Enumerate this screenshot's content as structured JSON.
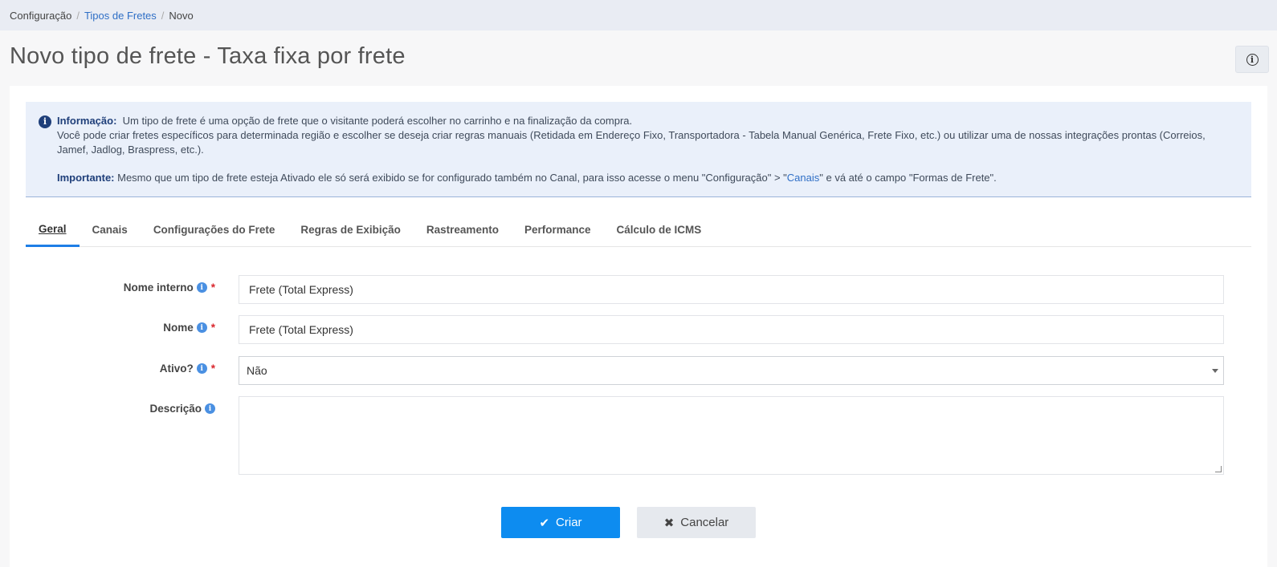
{
  "breadcrumb": {
    "root": "Configuração",
    "parent": "Tipos de Fretes",
    "current": "Novo",
    "separator": "/"
  },
  "page": {
    "title": "Novo tipo de frete - Taxa fixa por frete"
  },
  "alert": {
    "info_label": "Informação:",
    "line1": "Um tipo de frete é uma opção de frete que o visitante poderá escolher no carrinho e na finalização da compra.",
    "line2": "Você pode criar fretes específicos para determinada região e escolher se deseja criar regras manuais (Retidada em Endereço Fixo, Transportadora - Tabela Manual Genérica, Frete Fixo, etc.) ou utilizar uma de nossas integrações prontas (Correios, Jamef, Jadlog, Braspress, etc.).",
    "important_label": "Importante:",
    "important_text_a": "Mesmo que um tipo de frete esteja Ativado ele só será exibido se for configurado também no Canal, para isso acesse o menu \"Configuração\" > \"",
    "important_link": "Canais",
    "important_text_b": "\" e vá até o campo \"Formas de Frete\"."
  },
  "tabs": [
    {
      "label": "Geral",
      "active": true
    },
    {
      "label": "Canais"
    },
    {
      "label": "Configurações do Frete"
    },
    {
      "label": "Regras de Exibição"
    },
    {
      "label": "Rastreamento"
    },
    {
      "label": "Performance"
    },
    {
      "label": "Cálculo de ICMS"
    }
  ],
  "form": {
    "nome_interno": {
      "label": "Nome interno",
      "value": "Frete (Total Express)",
      "required": "*"
    },
    "nome": {
      "label": "Nome",
      "value": "Frete (Total Express)",
      "required": "*"
    },
    "ativo": {
      "label": "Ativo?",
      "value": "Não",
      "required": "*"
    },
    "descricao": {
      "label": "Descrição",
      "value": ""
    }
  },
  "buttons": {
    "criar": "Criar",
    "cancelar": "Cancelar"
  },
  "colors": {
    "primary": "#0d8cf0",
    "info_bg": "#eaf0fa",
    "required": "#d9262d",
    "link": "#2f6fc6"
  }
}
